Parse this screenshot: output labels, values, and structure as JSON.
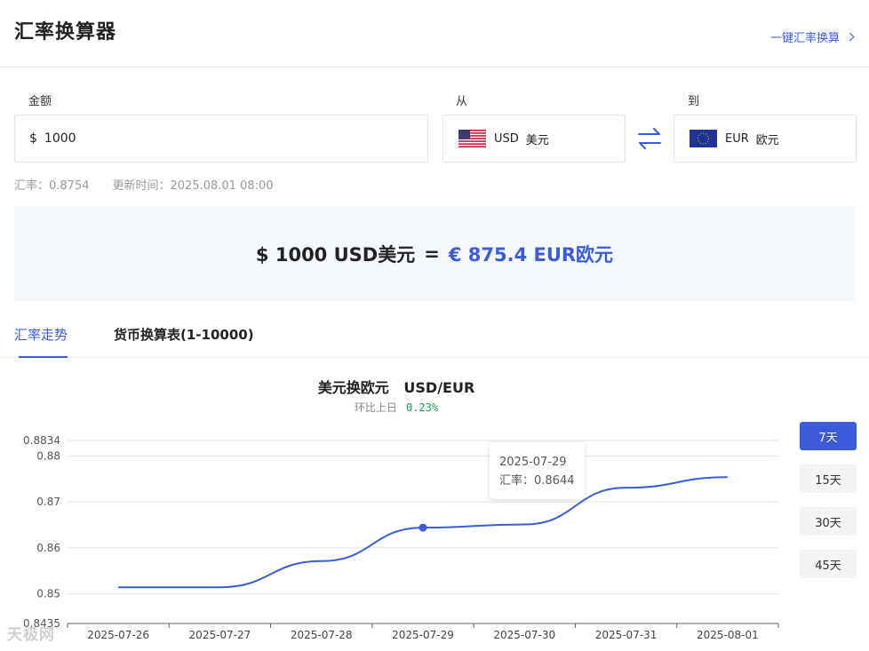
{
  "header": {
    "title": "汇率换算器",
    "oneclick_label": "一键汇率换算"
  },
  "form": {
    "amount_label": "金额",
    "amount_symbol": "$",
    "amount_value": "1000",
    "from_label": "从",
    "from_code": "USD",
    "from_name": "美元",
    "to_label": "到",
    "to_code": "EUR",
    "to_name": "欧元"
  },
  "rate_info": {
    "rate_text": "汇率：0.8754",
    "update_text": "更新时间：2025.08.01 08:00"
  },
  "result": {
    "lhs": "$ 1000 USD美元",
    "eq": "=",
    "rhs": "€ 875.4 EUR欧元"
  },
  "tabs": [
    {
      "label": "汇率走势"
    },
    {
      "label": "货币换算表(1-10000)"
    }
  ],
  "chart_header": {
    "title": "美元换欧元   USD/EUR",
    "sub_label": "环比上日",
    "sub_pct": "0.23%"
  },
  "range_buttons": [
    {
      "label": "7天"
    },
    {
      "label": "15天"
    },
    {
      "label": "30天"
    },
    {
      "label": "45天"
    }
  ],
  "tooltip": {
    "date": "2025-07-29",
    "rate_text": "汇率：0.8644"
  },
  "watermark": "天极网",
  "colors": {
    "accent": "#3b5bdb",
    "positive": "#1a9e4a",
    "result_bg": "#f5f8fd"
  },
  "chart_data": {
    "type": "line",
    "categories": [
      "2025-07-26",
      "2025-07-27",
      "2025-07-28",
      "2025-07-29",
      "2025-07-30",
      "2025-07-31",
      "2025-08-01"
    ],
    "values": [
      0.8514,
      0.8514,
      0.8571,
      0.8644,
      0.8651,
      0.8731,
      0.8754
    ],
    "ylim": [
      0.8435,
      0.8834
    ],
    "yticks": [
      "0.8834",
      "0.88",
      "0.87",
      "0.86",
      "0.85",
      "0.8435"
    ],
    "grid": true,
    "highlight_index": 3
  }
}
